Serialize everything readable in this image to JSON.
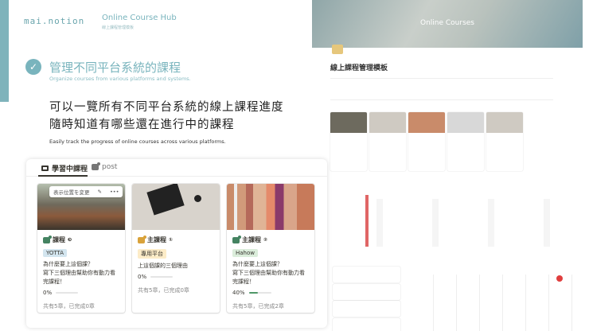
{
  "brand": {
    "logo": "mai.notion",
    "hub_title": "Online Course Hub",
    "hub_subtitle": "線上課程管理模板"
  },
  "feature": {
    "heading": "管理不同平台系統的課程",
    "heading_en": "Organize courses from various platforms and systems.",
    "line1": "可以一覽所有不同平台系統的線上課程進度",
    "line2": "隨時知道有哪些還在進行中的課程",
    "desc_en": "Easily track the progress of online courses across various platforms."
  },
  "background": {
    "cover_title": "Online Courses",
    "page_title": "線上課程管理模板",
    "colors": {
      "teal": "#79b4bd"
    }
  },
  "tabs": [
    {
      "label": "學習中課程",
      "icon": "gallery-icon"
    },
    {
      "label": "post",
      "icon": "post-icon"
    }
  ],
  "hover_toolbar": {
    "label": "表示位置を変更",
    "edit": "✎",
    "more": "•••"
  },
  "cards": [
    {
      "title": "課程",
      "tag": "YOTTA",
      "tag_bg": "#d3e5ef",
      "icon_color": "#448361",
      "desc": "為什麼要上這個課？\n寫下三個理由幫助你有動力看完課程！",
      "progress": "0%",
      "progress_value": 0,
      "chapters": "共有5章，已完成0章"
    },
    {
      "title": "主課程",
      "tag": "專用平台",
      "tag_bg": "#fdecc8",
      "icon_color": "#d9a23a",
      "desc": "上這個課的三個理由",
      "progress": "0%",
      "progress_value": 0,
      "chapters": "共有5章，已完成0章"
    },
    {
      "title": "主課程",
      "tag": "Hahow",
      "tag_bg": "#dbeddb",
      "icon_color": "#448361",
      "desc": "為什麼要上這個課？\n寫下三個理由幫助你有動力看完課程！",
      "progress": "40%",
      "progress_value": 40,
      "chapters": "共有5章，已完成2章"
    }
  ]
}
